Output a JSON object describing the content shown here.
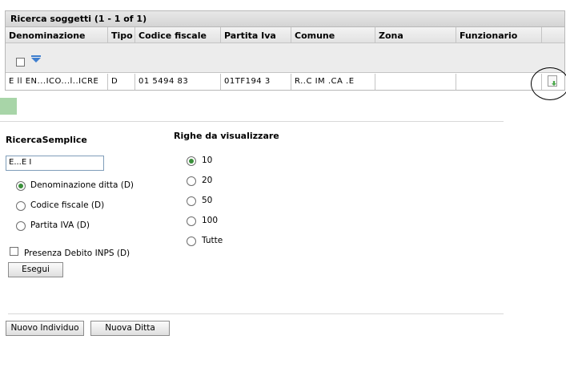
{
  "results": {
    "title": "Ricerca soggetti (1 - 1 of 1)",
    "columns": [
      "Denominazione",
      "Tipo",
      "Codice fiscale",
      "Partita Iva",
      "Comune",
      "Zona",
      "Funzionario"
    ],
    "rows": [
      {
        "denominazione": "E  ll EN...ICO...l..ICRE",
        "tipo": "D",
        "codice_fiscale": "01  5494    83",
        "partita_iva": "01TF194    3",
        "comune": "R..C   IM     .CA .E",
        "zona": "",
        "funzionario": ""
      }
    ]
  },
  "search": {
    "heading": "RicercaSemplice",
    "input_value": "E...E  I",
    "options": [
      "Denominazione ditta (D)",
      "Codice fiscale (D)",
      "Partita IVA (D)"
    ],
    "selected_option": "Denominazione ditta (D)",
    "checkbox_label": "Presenza Debito INPS (D)",
    "execute_label": "Esegui"
  },
  "rows_to_show": {
    "heading": "Righe da visualizzare",
    "options": [
      "10",
      "20",
      "50",
      "100",
      "Tutte"
    ],
    "selected": "10"
  },
  "footer": {
    "new_individual_label": "Nuovo Individuo",
    "new_company_label": "Nuova Ditta"
  }
}
